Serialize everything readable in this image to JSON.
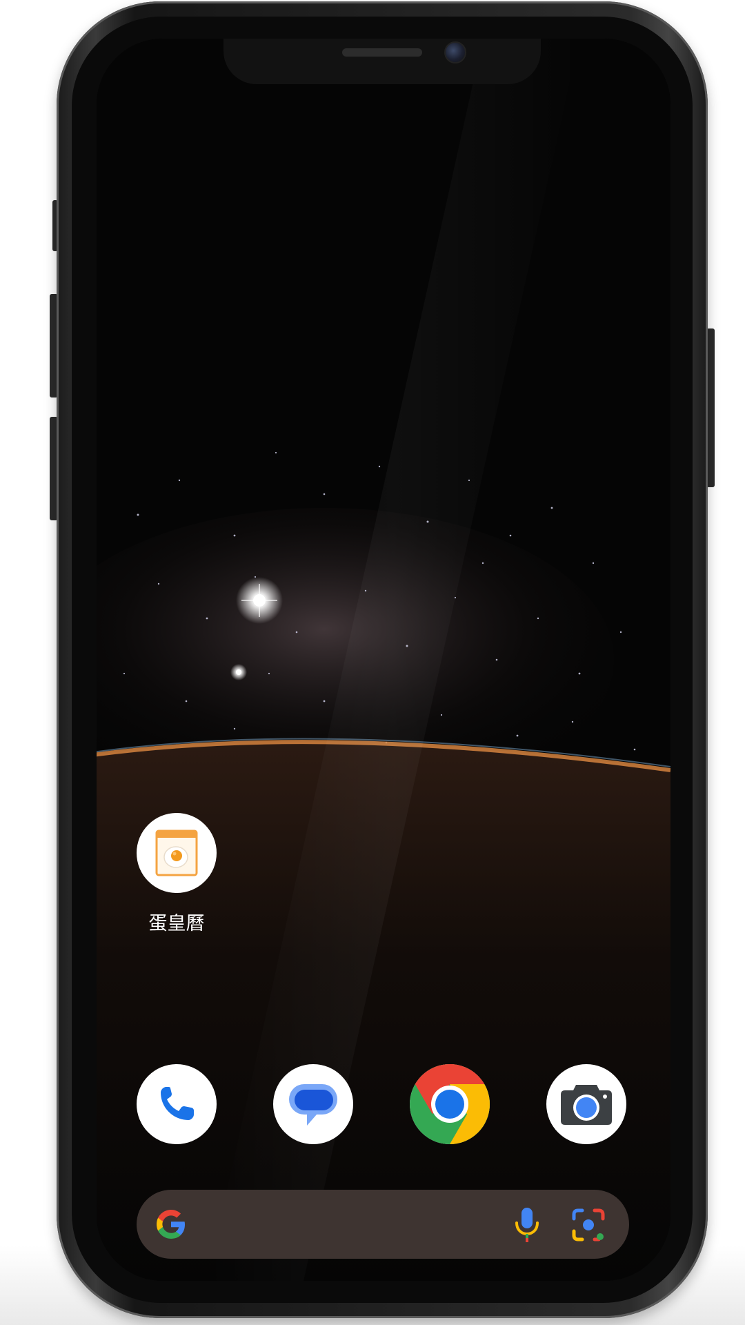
{
  "home_screen": {
    "apps": [
      {
        "label": "蛋皇曆",
        "icon": "calendar-egg-icon"
      }
    ],
    "dock": [
      {
        "icon": "phone-icon"
      },
      {
        "icon": "messages-icon"
      },
      {
        "icon": "chrome-icon"
      },
      {
        "icon": "camera-icon"
      }
    ],
    "search_bar": {
      "g_icon": "google-g-icon",
      "mic_icon": "microphone-icon",
      "lens_icon": "google-lens-icon"
    }
  },
  "colors": {
    "search_bar_bg": "#3e3431",
    "google_blue": "#4285F4",
    "google_red": "#EA4335",
    "google_yellow": "#FBBC05",
    "google_green": "#34A853"
  }
}
